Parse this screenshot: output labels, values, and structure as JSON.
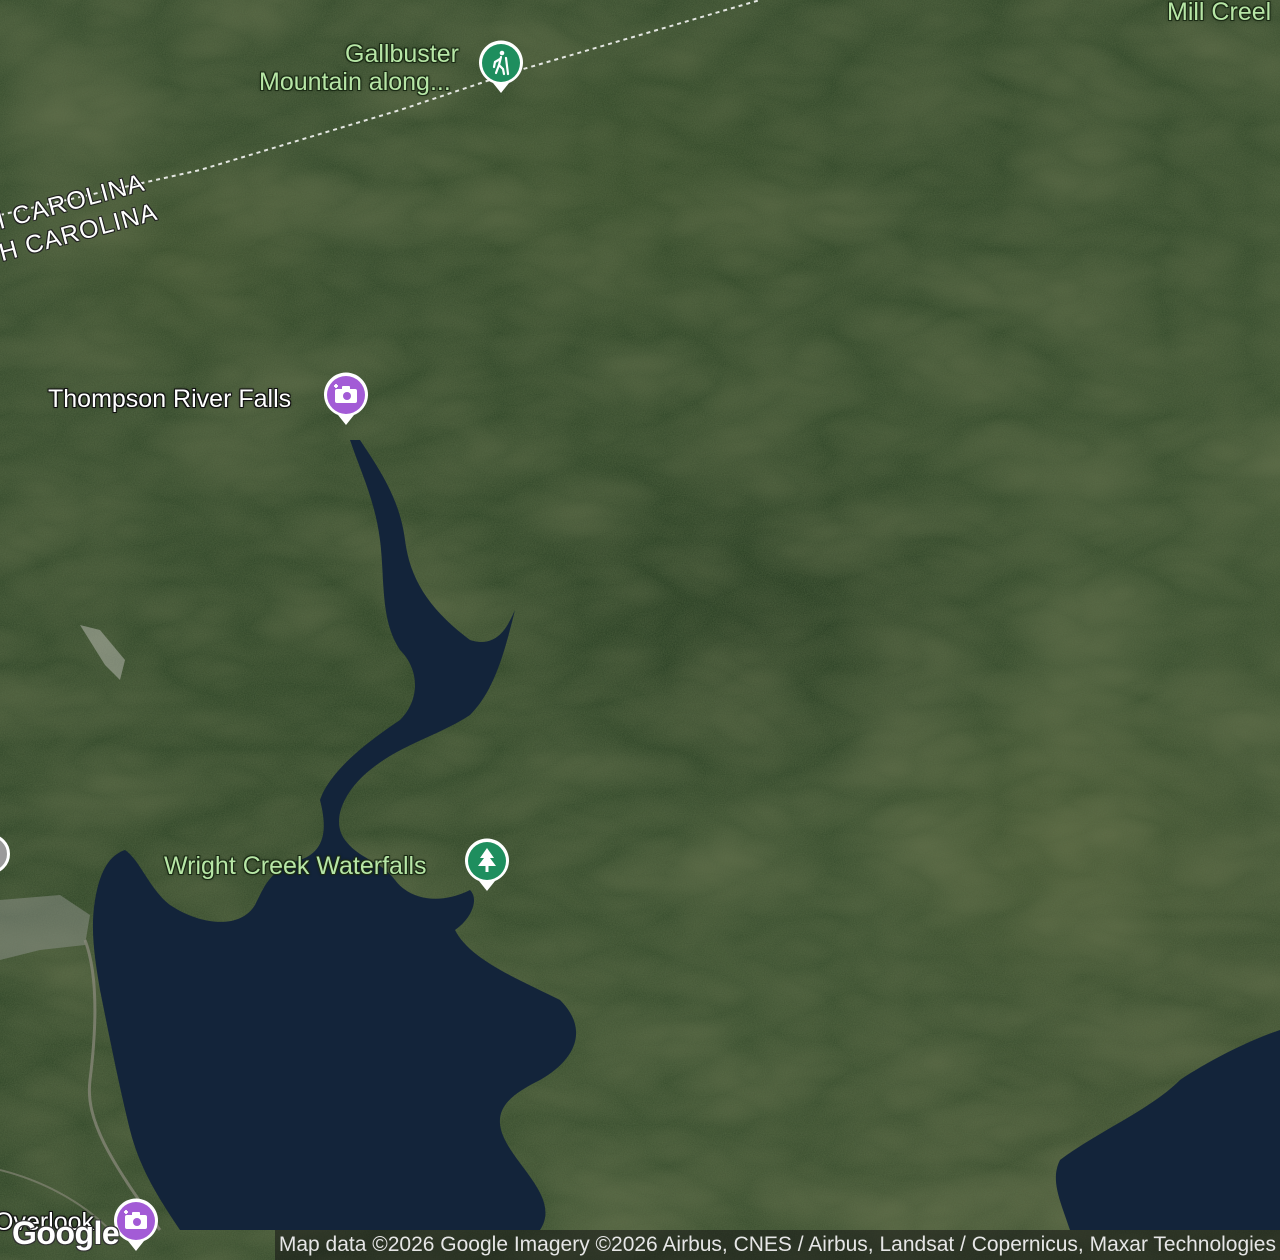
{
  "map": {
    "type": "satellite",
    "colors": {
      "forest_dark": "#263a20",
      "forest_mid": "#34492b",
      "forest_light": "#4d5a35",
      "water": "#13243a",
      "label_green": "#b7e6a6",
      "pin_green": "#1e8e5e",
      "pin_purple": "#a35bd6"
    }
  },
  "labels": {
    "mill_creek": "Mill Creel",
    "gallbuster_line1": "Gallbuster",
    "gallbuster_line2": "Mountain along...",
    "state_north": "I CAROLINA",
    "state_south": "H CAROLINA",
    "thompson_falls": "Thompson River Falls",
    "wright_creek": "Wright Creek Waterfalls",
    "overlook": "Overlook"
  },
  "pins": {
    "gallbuster": {
      "icon": "hiking-icon",
      "color": "#1e8e5e"
    },
    "thompson": {
      "icon": "camera-icon",
      "color": "#a35bd6"
    },
    "wright": {
      "icon": "tree-icon",
      "color": "#1e8e5e"
    },
    "overlook": {
      "icon": "camera-icon",
      "color": "#a35bd6"
    }
  },
  "footer": {
    "logo": "Google",
    "attribution": "Map data ©2026 Google Imagery ©2026 Airbus, CNES / Airbus, Landsat / Copernicus, Maxar Technologies"
  }
}
